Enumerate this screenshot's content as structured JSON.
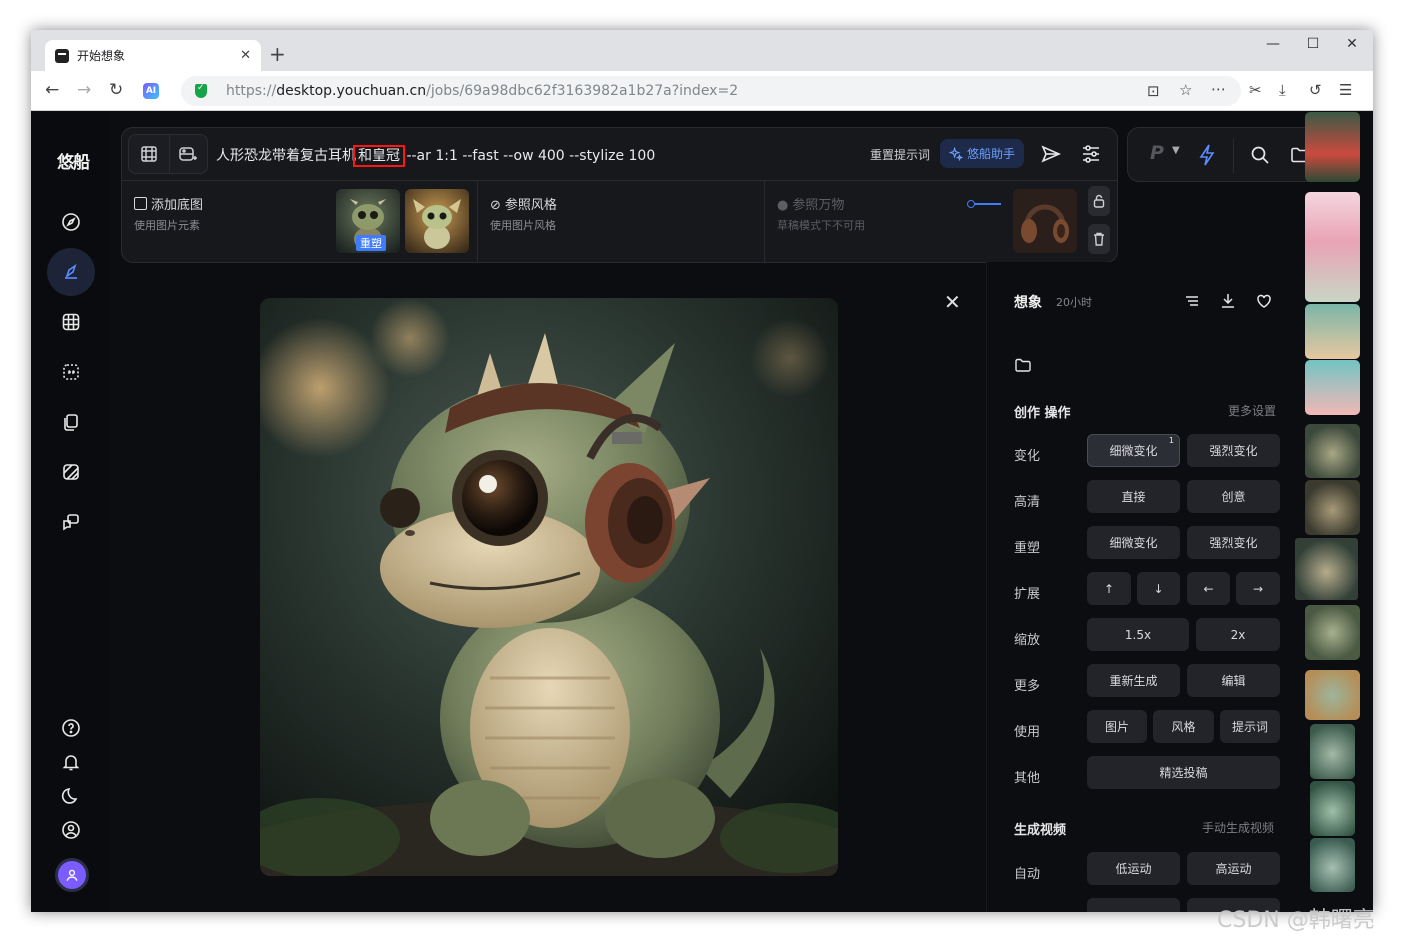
{
  "browser": {
    "tab_title": "开始想象",
    "url_prefix": "https://",
    "url_host": "desktop.youchuan.cn",
    "url_path": "/jobs/69a98dbc62f3163982a1b27a?index=2",
    "ai_badge": "AI"
  },
  "app": {
    "logo": "悠船",
    "prompt": {
      "text_before": "人形恐龙带着复古耳机",
      "highlighted": "和皇冠",
      "params": " --ar 1:1 --fast --ow 400 --stylize 100",
      "reset_label": "重置提示词",
      "assistant_label": "悠船助手"
    },
    "references": [
      {
        "title": "添加底图",
        "subtitle": "使用图片元素",
        "badge": "重塑"
      },
      {
        "title": "参照风格",
        "subtitle": "使用图片风格"
      },
      {
        "title": "参照万物",
        "subtitle": "草稿模式下不可用"
      }
    ],
    "version_letter": "P"
  },
  "details": {
    "title": "想象",
    "time": "20小时",
    "section_title": "创作 操作",
    "section_link": "更多设置",
    "rows": [
      {
        "label": "变化",
        "buttons": [
          "细微变化",
          "强烈变化"
        ],
        "badge": "1"
      },
      {
        "label": "高清",
        "buttons": [
          "直接",
          "创意"
        ]
      },
      {
        "label": "重塑",
        "buttons": [
          "细微变化",
          "强烈变化"
        ]
      },
      {
        "label": "扩展",
        "buttons": [
          "↑",
          "↓",
          "←",
          "→"
        ]
      },
      {
        "label": "缩放",
        "buttons": [
          "1.5x",
          "2x"
        ]
      },
      {
        "label": "更多",
        "buttons": [
          "重新生成",
          "编辑"
        ]
      },
      {
        "label": "使用",
        "buttons": [
          "图片",
          "风格",
          "提示词"
        ]
      },
      {
        "label": "其他",
        "buttons": [
          "精选投稿"
        ]
      }
    ],
    "video_title": "生成视频",
    "video_link": "手动生成视频",
    "video_row": {
      "label": "自动",
      "buttons": [
        "低运动",
        "高运动"
      ]
    }
  },
  "watermark": "CSDN @韩曙亮",
  "colors": {
    "accent": "#3e7bff",
    "highlight_box": "#ff1616",
    "assistant_text": "#6ea0ff"
  }
}
